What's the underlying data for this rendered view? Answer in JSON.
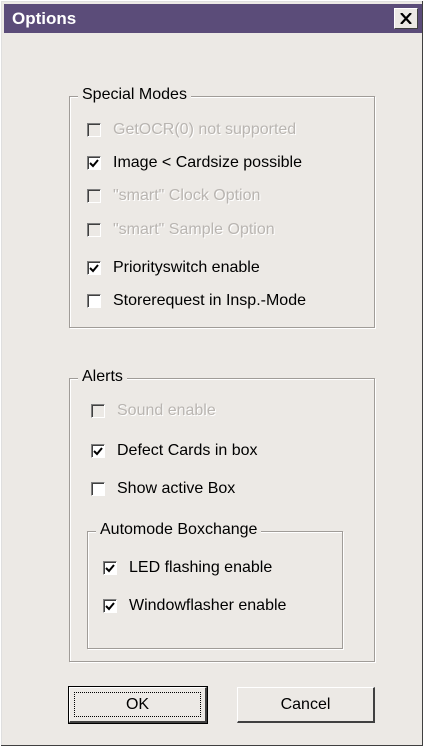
{
  "window": {
    "title": "Options",
    "close_glyph": "✕"
  },
  "special_modes": {
    "legend": "Special Modes",
    "items": [
      {
        "label": "GetOCR(0) not supported",
        "checked": false,
        "enabled": false
      },
      {
        "label": "Image < Cardsize possible",
        "checked": true,
        "enabled": true
      },
      {
        "label": "\"smart\" Clock Option",
        "checked": false,
        "enabled": false
      },
      {
        "label": "\"smart\" Sample Option",
        "checked": false,
        "enabled": false
      },
      {
        "label": "Priorityswitch enable",
        "checked": true,
        "enabled": true
      },
      {
        "label": "Storerequest in Insp.-Mode",
        "checked": false,
        "enabled": true
      }
    ]
  },
  "alerts": {
    "legend": "Alerts",
    "items": [
      {
        "label": "Sound enable",
        "checked": false,
        "enabled": false
      },
      {
        "label": "Defect Cards in box",
        "checked": true,
        "enabled": true
      },
      {
        "label": "Show active Box",
        "checked": false,
        "enabled": true
      }
    ],
    "automode": {
      "legend": "Automode Boxchange",
      "items": [
        {
          "label": "LED flashing enable",
          "checked": true,
          "enabled": true
        },
        {
          "label": "Windowflasher enable",
          "checked": true,
          "enabled": true
        }
      ]
    }
  },
  "buttons": {
    "ok": "OK",
    "cancel": "Cancel"
  }
}
